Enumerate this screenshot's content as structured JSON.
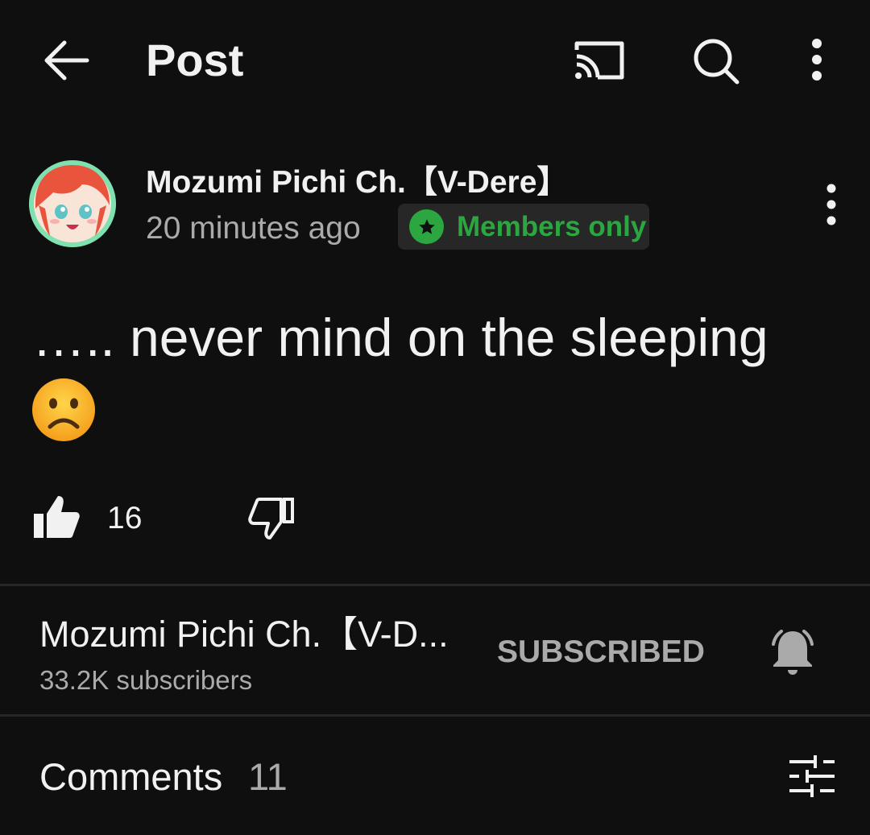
{
  "header": {
    "title": "Post",
    "icons": [
      "back-arrow-icon",
      "cast-icon",
      "search-icon",
      "more-vertical-icon"
    ]
  },
  "post": {
    "channel_name": "Mozumi Pichi Ch.【V-Dere】",
    "time": "20 minutes ago",
    "badge": "Members only",
    "text": "….. never mind on the sleeping",
    "emoji": "☹️",
    "like_count": "16"
  },
  "channel": {
    "name": "Mozumi Pichi Ch.【V-D...",
    "subscribers": "33.2K subscribers",
    "subscribe_state": "SUBSCRIBED"
  },
  "comments": {
    "label": "Comments",
    "count": "11"
  },
  "colors": {
    "background": "#0f0f0f",
    "members_green": "#2ba640",
    "secondary_text": "#aaaaaa",
    "divider": "#272727"
  }
}
